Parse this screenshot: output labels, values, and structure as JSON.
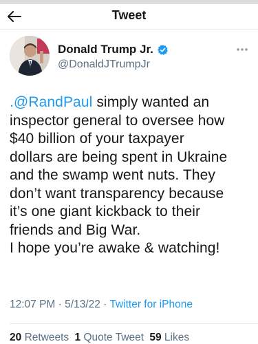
{
  "header": {
    "title": "Tweet"
  },
  "author": {
    "display_name": "Donald Trump Jr.",
    "handle": "@DonaldJTrumpJr"
  },
  "tweet": {
    "mention": ".@RandPaul",
    "line1_rest": " simply wanted an",
    "line2": "inspector general to oversee how",
    "line3": "$40 billion of your taxpayer",
    "line4": "dollars are being spent in Ukraine",
    "line5": "and the swamp went nuts. They",
    "line6": "don’t want transparency because",
    "line7": "it’s one giant kickback to their",
    "line8": "friends and Big War.",
    "line9": "I hope you’re awake & watching!"
  },
  "meta": {
    "time": "12:07 PM",
    "sep1": " · ",
    "date": "5/13/22",
    "sep2": " · ",
    "source": "Twitter for iPhone"
  },
  "stats": {
    "retweets_count": "20",
    "retweets_label": "Retweets",
    "quotes_count": "1",
    "quotes_label": "Quote Tweet",
    "likes_count": "59",
    "likes_label": "Likes"
  },
  "colors": {
    "accent": "#1d9bf0",
    "secondary_text": "#5b7083",
    "primary_text": "#14171a"
  },
  "icons": {
    "back": "arrow-left-icon",
    "verified": "verified-badge-icon",
    "more": "more-dots-icon"
  }
}
